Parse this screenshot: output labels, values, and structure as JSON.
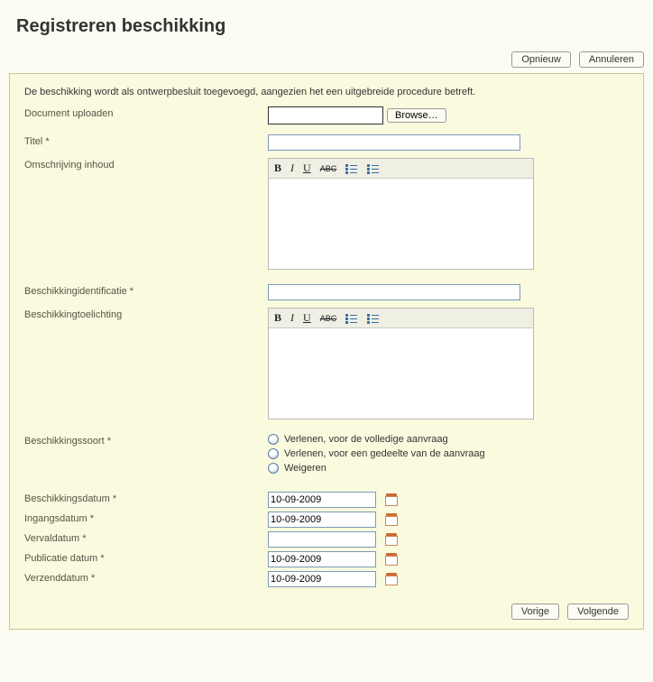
{
  "page": {
    "title": "Registreren beschikking"
  },
  "actions": {
    "opnieuw": "Opnieuw",
    "annuleren": "Annuleren",
    "vorige": "Vorige",
    "volgende": "Volgende"
  },
  "panel": {
    "intro": "De beschikking wordt als ontwerpbesluit toegevoegd, aangezien het een uitgebreide procedure betreft."
  },
  "fields": {
    "document_upload_label": "Document uploaden",
    "browse_label": "Browse…",
    "titel_label": "Titel *",
    "titel_value": "",
    "omschrijving_label": "Omschrijving inhoud",
    "beschikkingidentificatie_label": "Beschikkingidentificatie *",
    "beschikkingidentificatie_value": "",
    "beschikkingtoelichting_label": "Beschikkingtoelichting",
    "beschikkingssoort_label": "Beschikkingssoort *",
    "beschikkingssoort_options": {
      "opt1": "Verlenen, voor de volledige aanvraag",
      "opt2": "Verlenen, voor een gedeelte van de aanvraag",
      "opt3": "Weigeren"
    },
    "beschikkingsdatum_label": "Beschikkingsdatum *",
    "beschikkingsdatum_value": "10-09-2009",
    "ingangsdatum_label": "Ingangsdatum *",
    "ingangsdatum_value": "10-09-2009",
    "vervaldatum_label": "Vervaldatum *",
    "vervaldatum_value": "",
    "publicatiedatum_label": "Publicatie datum *",
    "publicatiedatum_value": "10-09-2009",
    "verzenddatum_label": "Verzenddatum *",
    "verzenddatum_value": "10-09-2009"
  },
  "editor_toolbar": {
    "bold": "B",
    "italic": "I",
    "underline": "U",
    "strike": "ABC"
  }
}
